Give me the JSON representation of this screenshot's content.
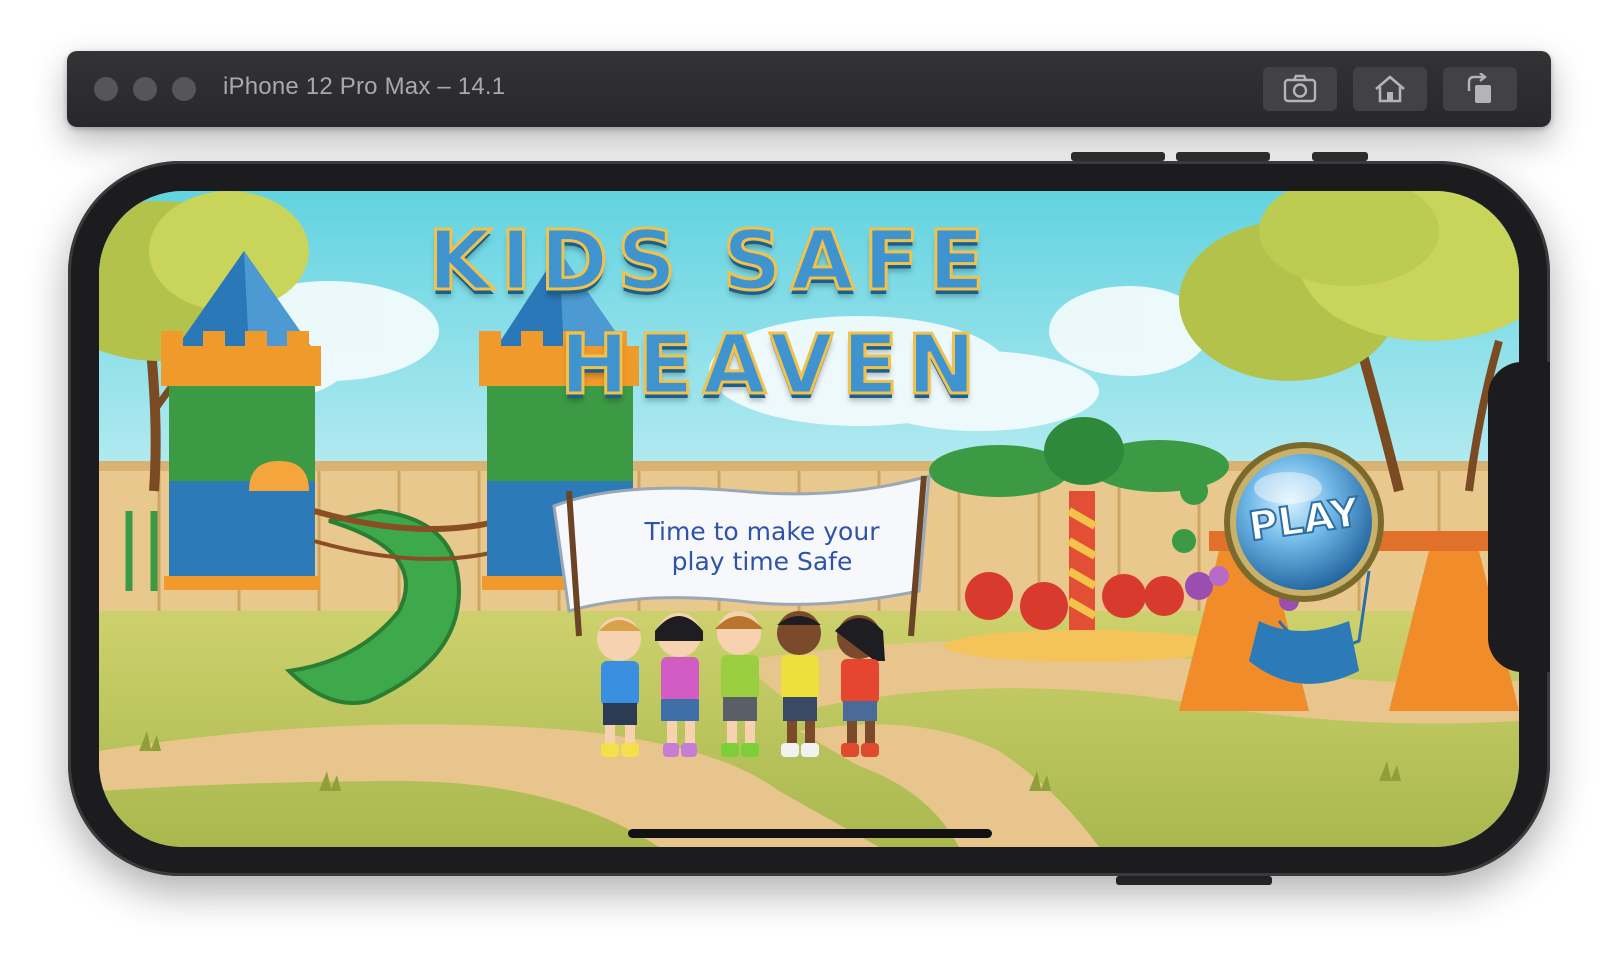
{
  "simulator": {
    "title": "iPhone 12 Pro Max – 14.1",
    "buttons": [
      {
        "name": "screenshot",
        "icon": "camera-icon"
      },
      {
        "name": "home",
        "icon": "home-icon"
      },
      {
        "name": "rotate",
        "icon": "rotate-icon"
      }
    ]
  },
  "game": {
    "title_line1": "KIDS SAFE",
    "title_line2": "HEAVEN",
    "banner_line1": "Time to make your",
    "banner_line2": "play time Safe",
    "play_label": "PLAY"
  },
  "colors": {
    "sky": "#7fd6e6",
    "title_blue": "#3f94cf",
    "title_outline": "#f0c24c",
    "banner_text": "#2f53a8",
    "grass": "#c9cd63"
  }
}
